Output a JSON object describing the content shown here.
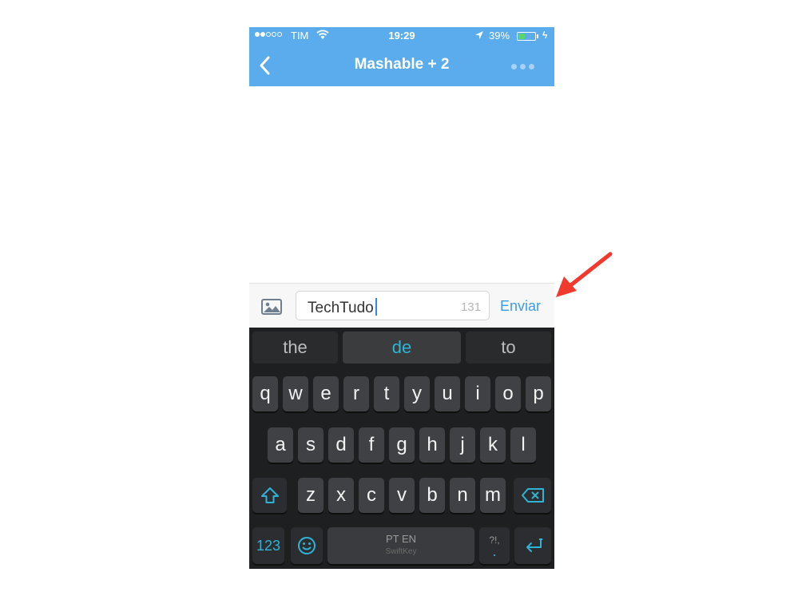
{
  "status_bar": {
    "carrier": "TIM",
    "time": "19:29",
    "battery": "39%",
    "battery_level": 0.39
  },
  "header": {
    "title": "Mashable + 2",
    "accent_color": "#5aacec"
  },
  "compose": {
    "text": "TechTudo",
    "counter": "131",
    "send_label": "Enviar"
  },
  "keyboard": {
    "suggestions": [
      "the",
      "de",
      "to"
    ],
    "row1": [
      "q",
      "w",
      "e",
      "r",
      "t",
      "y",
      "u",
      "i",
      "o",
      "p"
    ],
    "row2": [
      "a",
      "s",
      "d",
      "f",
      "g",
      "h",
      "j",
      "k",
      "l"
    ],
    "row3": [
      "z",
      "x",
      "c",
      "v",
      "b",
      "n",
      "m"
    ],
    "numbers_label": "123",
    "punct_label": "?!,",
    "punct_dot": ".",
    "space_label": "PT EN",
    "brand": "SwiftKey",
    "accent_color": "#2fb4d6"
  },
  "icons": {
    "back": "chevron-left-icon",
    "more": "more-dots-icon",
    "photo": "image-icon",
    "shift": "shift-icon",
    "backspace": "backspace-icon",
    "emoji": "emoji-icon",
    "return": "return-icon",
    "annotation": "red-arrow-icon"
  }
}
